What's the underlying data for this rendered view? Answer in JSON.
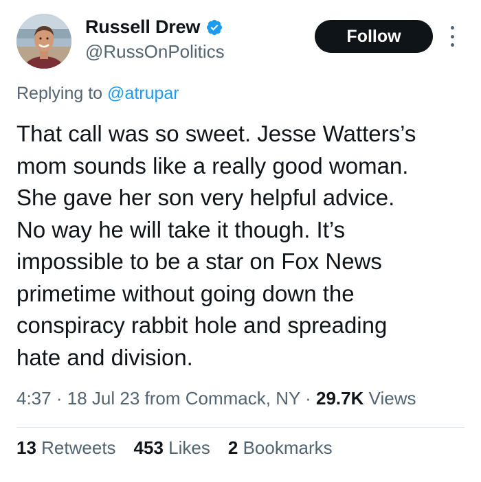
{
  "user": {
    "display_name": "Russell Drew",
    "handle": "@RussOnPolitics",
    "verified": true
  },
  "follow_button": "Follow",
  "reply": {
    "prefix": "Replying to",
    "mention": "@atrupar"
  },
  "tweet": {
    "text": "That call was so sweet. Jesse Watters’s\nmom sounds like a really good woman.\nShe gave her son very helpful advice.\nNo way he will take it though. It’s\nimpossible to be a star on Fox News\nprimetime without going down the\nconspiracy rabbit hole and spreading\nhate and division."
  },
  "meta": {
    "time": "4:37",
    "date": "18 Jul 23",
    "location": "from Commack, NY",
    "views_count": "29.7K",
    "views_label": "Views",
    "separator": "·"
  },
  "stats": {
    "retweets_count": "13",
    "retweets_label": "Retweets",
    "likes_count": "453",
    "likes_label": "Likes",
    "bookmarks_count": "2",
    "bookmarks_label": "Bookmarks"
  },
  "colors": {
    "text": "#0f1419",
    "secondary": "#536471",
    "accent": "#1d9bf0",
    "follow_bg": "#0f1419",
    "divider": "#e1e8ed"
  },
  "icons": {
    "verified": "verified-badge-icon",
    "more": "more-options-icon"
  }
}
